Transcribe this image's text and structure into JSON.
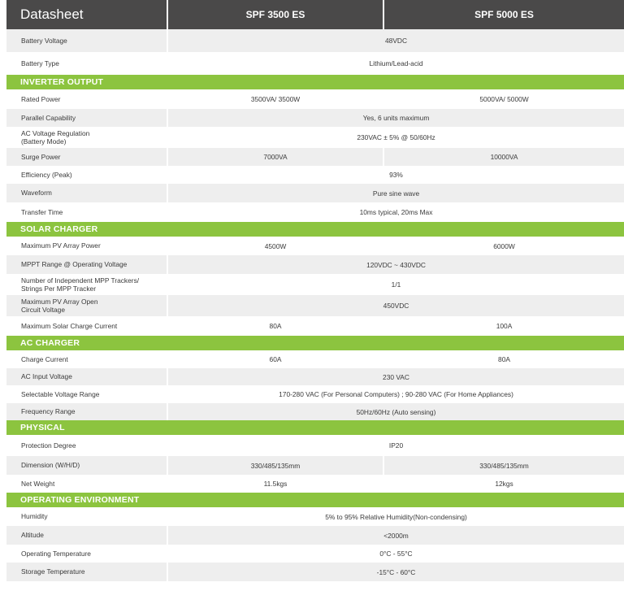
{
  "header": {
    "title": "Datasheet",
    "model_a": "SPF 3500 ES",
    "model_b": "SPF 5000 ES"
  },
  "sections": [
    {
      "title": "",
      "rows": [
        {
          "label": "Battery Voltage",
          "value": "48VDC"
        },
        {
          "label": "Battery Type",
          "value": "Lithium/Lead-acid"
        }
      ]
    },
    {
      "title": "INVERTER OUTPUT",
      "rows": [
        {
          "label": "Rated Power",
          "a": "3500VA/ 3500W",
          "b": "5000VA/ 5000W"
        },
        {
          "label": "Parallel Capability",
          "value": "Yes, 6 units maximum"
        },
        {
          "label": "AC Voltage Regulation\n(Battery Mode)",
          "value": "230VAC ± 5% @ 50/60Hz"
        },
        {
          "label": "Surge Power",
          "a": "7000VA",
          "b": "10000VA"
        },
        {
          "label": "Efficiency (Peak)",
          "value": "93%"
        },
        {
          "label": "Waveform",
          "value": "Pure sine wave"
        },
        {
          "label": "Transfer Time",
          "value": "10ms typical, 20ms Max"
        }
      ]
    },
    {
      "title": "SOLAR CHARGER",
      "rows": [
        {
          "label": "Maximum PV Array Power",
          "a": "4500W",
          "b": "6000W"
        },
        {
          "label": "MPPT Range @ Operating Voltage",
          "value": "120VDC ~ 430VDC"
        },
        {
          "label": "Number of Independent MPP Trackers/\nStrings Per MPP Tracker",
          "value": "1/1"
        },
        {
          "label": "Maximum PV Array Open\nCircuit Voltage",
          "value": "450VDC"
        },
        {
          "label": "Maximum Solar Charge Current",
          "a": "80A",
          "b": "100A"
        }
      ]
    },
    {
      "title": "AC CHARGER",
      "rows": [
        {
          "label": "Charge Current",
          "a": "60A",
          "b": "80A"
        },
        {
          "label": "AC Input Voltage",
          "value": "230 VAC"
        },
        {
          "label": "Selectable Voltage Range",
          "value": "170-280 VAC (For Personal Computers) ; 90-280 VAC (For Home Appliances)"
        },
        {
          "label": "Frequency Range",
          "value": "50Hz/60Hz (Auto sensing)"
        }
      ]
    },
    {
      "title": "PHYSICAL",
      "rows": [
        {
          "label": "Protection Degree",
          "value": "IP20"
        },
        {
          "label": "Dimension (W/H/D)",
          "a": "330/485/135mm",
          "b": "330/485/135mm"
        },
        {
          "label": "Net Weight",
          "a": "11.5kgs",
          "b": "12kgs"
        }
      ]
    },
    {
      "title": "OPERATING ENVIRONMENT",
      "rows": [
        {
          "label": "Humidity",
          "value": "5% to 95% Relative Humidity(Non-condensing)"
        },
        {
          "label": "Altitude",
          "value": "<2000m"
        },
        {
          "label": "Operating Temperature",
          "value": "0°C - 55°C"
        },
        {
          "label": "Storage Temperature",
          "value": "-15°C - 60°C"
        }
      ]
    }
  ]
}
